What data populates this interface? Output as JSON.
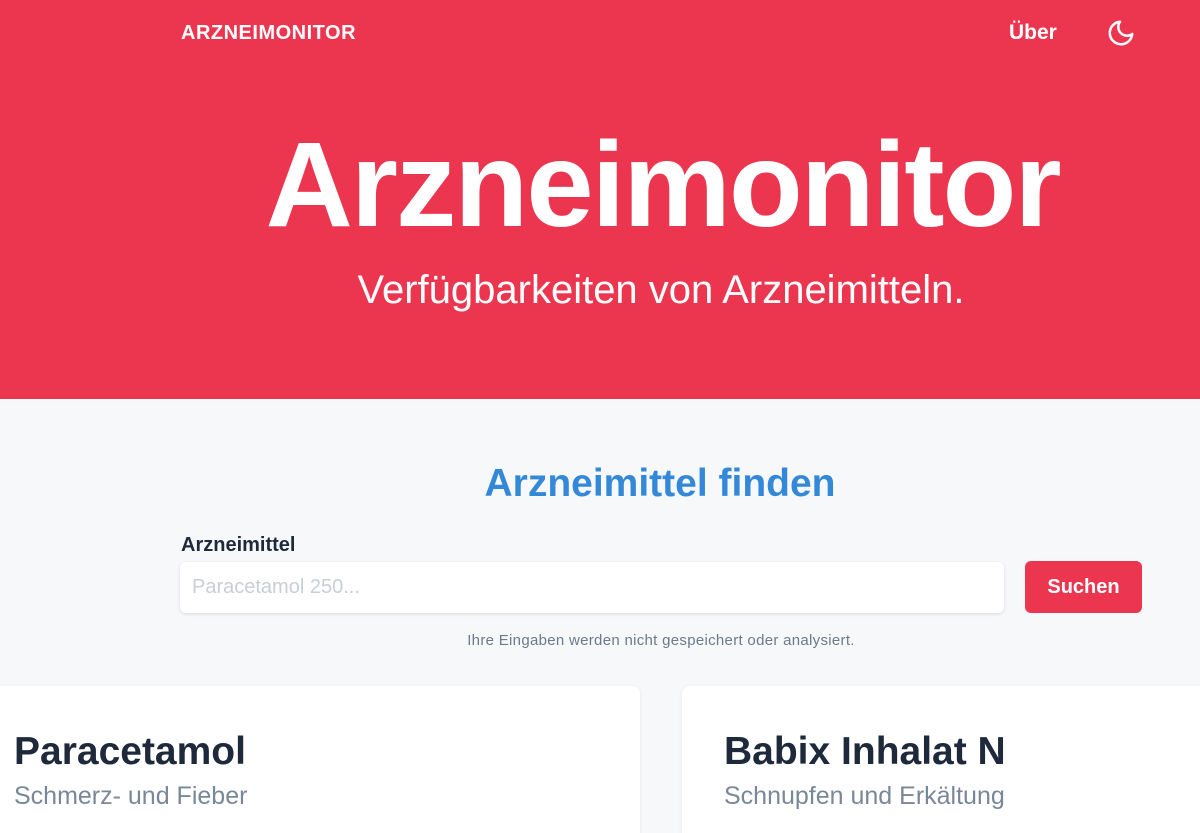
{
  "nav": {
    "brand": "ARZNEIMONITOR",
    "about": "Über",
    "theme_toggle_icon": "moon-icon"
  },
  "hero": {
    "title": "Arzneimonitor",
    "subtitle": "Verfügbarkeiten von Arzneimitteln."
  },
  "search": {
    "title": "Arzneimittel finden",
    "label": "Arzneimittel",
    "placeholder": "Paracetamol 250...",
    "value": "",
    "button": "Suchen",
    "privacy_note": "Ihre Eingaben werden nicht gespeichert oder analysiert."
  },
  "cards": [
    {
      "title": "Paracetamol",
      "subtitle": "Schmerz- und Fieber"
    },
    {
      "title": "Babix Inhalat N",
      "subtitle": "Schnupfen und Erkältung"
    }
  ],
  "colors": {
    "brand_red": "#ec364f",
    "accent_blue": "#3488d8",
    "page_bg": "#f7f8fa",
    "text_dark": "#1e2a3b"
  }
}
